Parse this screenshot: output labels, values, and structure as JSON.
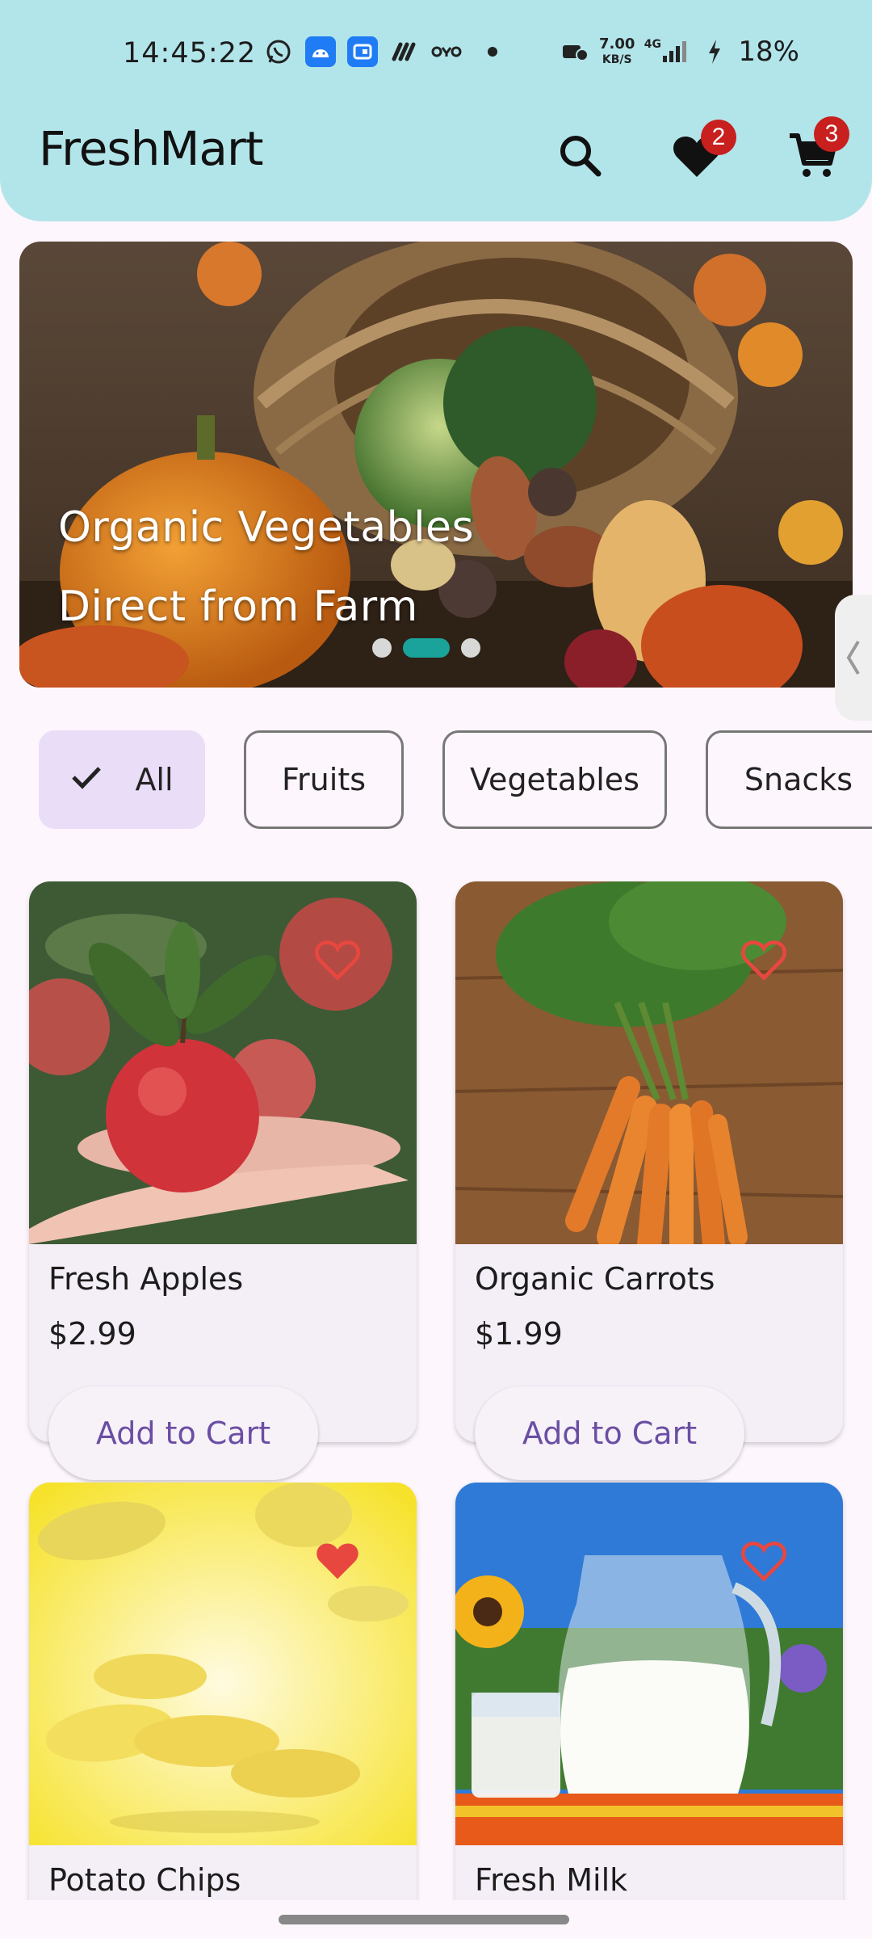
{
  "status_bar": {
    "time": "14:45:22",
    "net_speed_value": "7.00",
    "net_speed_unit": "KB/S",
    "network": "4G",
    "battery": "18%"
  },
  "header": {
    "title": "FreshMart",
    "wishlist_count": "2",
    "cart_count": "3"
  },
  "banner": {
    "line1": "Organic Vegetables",
    "line2": "Direct from Farm",
    "slides": 3,
    "active_slide": 2
  },
  "categories": [
    {
      "label": "All",
      "selected": true
    },
    {
      "label": "Fruits",
      "selected": false
    },
    {
      "label": "Vegetables",
      "selected": false
    },
    {
      "label": "Snacks",
      "selected": false
    }
  ],
  "products": [
    {
      "name": "Fresh Apples",
      "price": "$2.99",
      "favorite": false,
      "button": "Add to Cart"
    },
    {
      "name": "Organic Carrots",
      "price": "$1.99",
      "favorite": false,
      "button": "Add to Cart"
    },
    {
      "name": "Potato Chips",
      "price": "",
      "favorite": true,
      "button": ""
    },
    {
      "name": "Fresh Milk",
      "price": "",
      "favorite": false,
      "button": ""
    }
  ],
  "colors": {
    "header_bg": "#b2e5ea",
    "page_bg": "#fdf6fd",
    "accent_teal": "#1aa39b",
    "heart_red": "#e8473f",
    "badge_red": "#c81f1f",
    "button_text": "#6a4ea3",
    "chip_selected": "#e9ddf7"
  }
}
